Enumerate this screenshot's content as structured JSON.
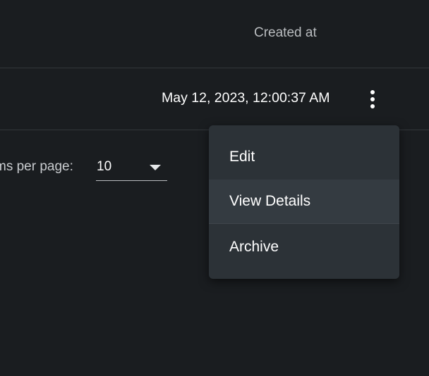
{
  "table": {
    "header": {
      "created_at_label": "Created at"
    },
    "rows": [
      {
        "created_at": "May 12, 2023, 12:00:37 AM",
        "actions_icon": "more-vertical-icon"
      }
    ]
  },
  "pagination": {
    "items_per_page_label": "ms per page:",
    "items_per_page_value": "10",
    "dropdown_icon": "caret-down-icon"
  },
  "row_menu": {
    "items": [
      {
        "label": "Edit"
      },
      {
        "label": "View Details"
      },
      {
        "label": "Archive"
      }
    ]
  },
  "colors": {
    "background": "#1a1d20",
    "menu_background": "#2c3237",
    "menu_hover": "#343b41",
    "divider": "#33373b",
    "text": "#ffffff",
    "muted_text": "#b9bcbf"
  }
}
